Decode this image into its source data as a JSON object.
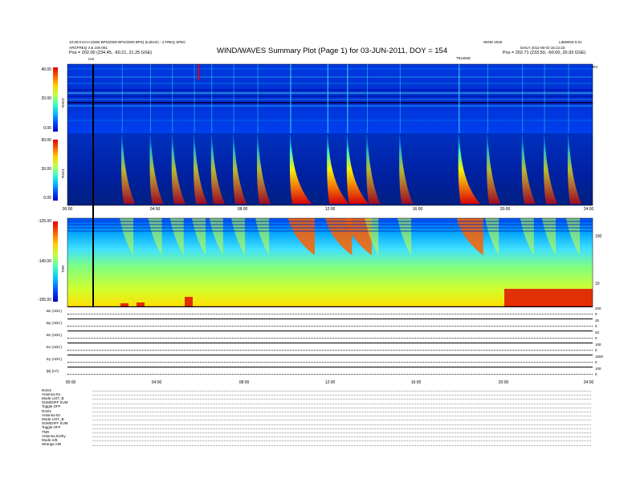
{
  "header": {
    "title": "WIND/WAVES Summary Plot (Page 1) for 03-JUN-2011, DOY = 154",
    "left_line1": "10:30:0 KCH (2000 BPS/2000 BPS/2000 BPS) (6.5kHz) - 4 FREQ SPEC",
    "left_line2": "ARGFREQ 3 & 100 001",
    "left_line3": "Pos = 202.00 (234.45, -60.21, 21.25 GSE)",
    "right_line1": "WIND 2040",
    "right_line1b": "LIBWIND 5.01",
    "right_line2": "DAILY 2011-06-03 16:12:23",
    "right_line3": "Pos = 202.71 (233.50, -60.00, 20.93 GSE)",
    "right_small": "TELWSE",
    "mark_left": "Cal",
    "mark_topright": "NR3"
  },
  "panels": {
    "rad2": {
      "label": "RAD2",
      "ticks": [
        "40.00",
        "20.00",
        "0.00"
      ]
    },
    "rad1": {
      "label": "RAD1",
      "ticks": [
        "60.00",
        "30.00",
        "0.00"
      ]
    },
    "tnr": {
      "label": "TNR",
      "ticks": [
        "-125.00",
        "-140.00",
        "-155.00"
      ],
      "right_ticks": [
        "100",
        "10"
      ],
      "right_label": "kHz"
    }
  },
  "x_ticks_top": [
    "00:00",
    "04:00",
    "08:00",
    "12:00",
    "16:00",
    "20:00",
    "24:00"
  ],
  "x_ticks_bottom": [
    "00:00",
    "04:00",
    "08:00",
    "12:00",
    "16:00",
    "20:00",
    "24:00"
  ],
  "traces": [
    {
      "label": "Bx (ADC)",
      "rticks": [
        "200",
        "0"
      ]
    },
    {
      "label": "By (ADC)",
      "rticks": [
        "20",
        "0"
      ]
    },
    {
      "label": "Bz (ADC)",
      "rticks": [
        "20",
        "0"
      ]
    },
    {
      "label": "Ex (ADC)",
      "rticks": [
        "100",
        "0"
      ]
    },
    {
      "label": "Ey (ADC)",
      "rticks": [
        "1000",
        "0"
      ]
    },
    {
      "label": "|B| (nT)",
      "rticks": [
        "100",
        "0"
      ]
    }
  ],
  "footer": {
    "rad2_block": [
      "RAD2",
      "Antenna  Ex",
      "Mode  LIST_B",
      "SUM/DIFF SUM",
      "Toggle  OFF"
    ],
    "rad1_block": [
      "RAD1",
      "Antenna  Ex",
      "Mode  LIST_B",
      "SUM/DIFF SUM",
      "Toggle  OFF"
    ],
    "tnr_block": [
      "TNR",
      "Antenna  Ex/Ey",
      "Mode  A/B",
      "Strange  A/B"
    ]
  },
  "chart_data": {
    "type": "heatmap",
    "title": "WIND/WAVES Summary Plot (Page 1) for 03-JUN-2011, DOY = 154",
    "xlabel": "",
    "x_range_hours": [
      0,
      24
    ],
    "panels": [
      {
        "name": "RAD2",
        "ylim": [
          0,
          40
        ]
      },
      {
        "name": "RAD1",
        "ylim": [
          0,
          60
        ]
      },
      {
        "name": "TNR",
        "ylim": [
          -155,
          -125
        ]
      }
    ],
    "type_iii_bursts_hours": [
      2.5,
      3.8,
      4.8,
      5.8,
      6.6,
      7.6,
      8.7,
      10.2,
      11.9,
      12.8,
      13.7,
      15.2,
      17.9,
      19.2,
      20.8,
      21.8,
      22.9
    ],
    "colormap": [
      "#000000",
      "#0000c0",
      "#0050ff",
      "#00c0ff",
      "#40ffc0",
      "#c0ff40",
      "#ffd000",
      "#ff6000",
      "#e00000"
    ]
  }
}
